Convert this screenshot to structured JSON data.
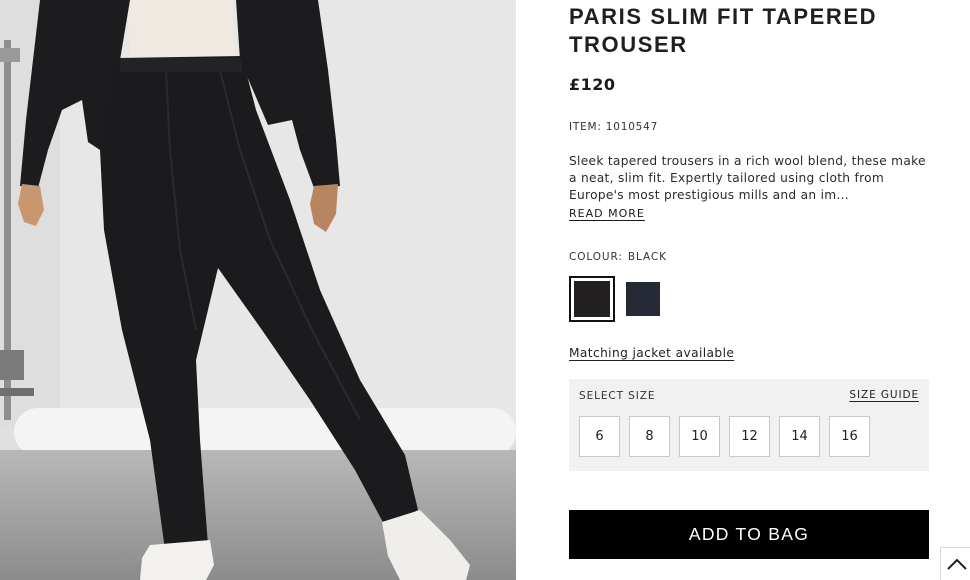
{
  "product": {
    "title": "PARIS SLIM FIT TAPERED TROUSER",
    "price": "£120",
    "item_label": "ITEM:",
    "item_number": "1010547",
    "description": "Sleek tapered trousers in a rich wool blend, these make a neat, slim fit. Expertly tailored using cloth from Europe's most prestigious mills and an im...",
    "read_more": "READ MORE",
    "colour_label": "COLOUR:",
    "colour_value": "BLACK",
    "swatches": [
      {
        "name": "black",
        "color": "#221f20",
        "selected": true
      },
      {
        "name": "navy",
        "color": "#262a36",
        "selected": false
      }
    ],
    "matching_link": "Matching jacket available"
  },
  "sizes": {
    "label": "SELECT SIZE",
    "guide_label": "SIZE GUIDE",
    "options": [
      "6",
      "8",
      "10",
      "12",
      "14",
      "16"
    ]
  },
  "actions": {
    "add_to_bag": "ADD TO BAG",
    "scroll_top_icon": "chevron-up-icon"
  },
  "photo": {
    "subject": "model-wearing-black-trousers",
    "colors": {
      "backdrop": "#e6e6e6",
      "garment": "#1b1b1d",
      "floor": "#9b9b9b"
    }
  }
}
